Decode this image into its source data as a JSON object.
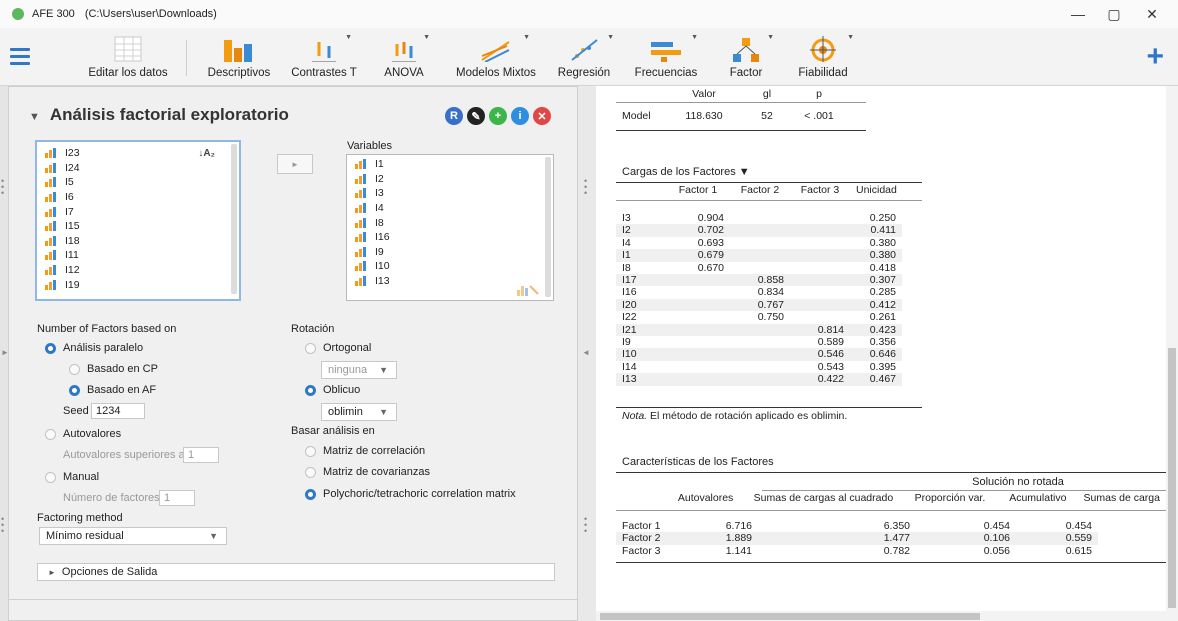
{
  "window": {
    "app_name": "AFE 300",
    "path": "(C:\\Users\\user\\Downloads)",
    "minimize": "—",
    "restore": "▢",
    "close": "✕"
  },
  "ribbon": {
    "buttons": [
      "Editar los datos",
      "Descriptivos",
      "Contrastes T",
      "ANOVA",
      "Modelos Mixtos",
      "Regresión",
      "Frecuencias",
      "Factor",
      "Fiabilidad"
    ],
    "plus": "+"
  },
  "analysis": {
    "title": "Análisis factorial exploratorio",
    "header_buttons": [
      "R",
      "✎",
      "+",
      "i",
      "✕"
    ],
    "available_vars": [
      "I23",
      "I24",
      "I5",
      "I6",
      "I7",
      "I15",
      "I18",
      "I11",
      "I12",
      "I19"
    ],
    "variables_label": "Variables",
    "selected_vars": [
      "I1",
      "I2",
      "I3",
      "I4",
      "I8",
      "I16",
      "I9",
      "I10",
      "I13"
    ],
    "sort_icon": "↓A₂",
    "move_arrow": "►",
    "nfactors": {
      "label": "Number of Factors based on",
      "parallel": "Análisis paralelo",
      "based_cp": "Basado en CP",
      "based_af": "Basado en AF",
      "seed_label": "Seed",
      "seed_value": "1234",
      "eigen": "Autovalores",
      "eigen_above": "Autovalores superiores a",
      "eigen_value": "1",
      "manual": "Manual",
      "nfactor_label": "Número de factores",
      "nfactor_value": "1"
    },
    "factoring": {
      "label": "Factoring method",
      "value": "Mínimo residual"
    },
    "rotation": {
      "label": "Rotación",
      "orthogonal": "Ortogonal",
      "orth_value": "ninguna",
      "oblique": "Oblicuo",
      "obl_value": "oblimin"
    },
    "base": {
      "label": "Basar análisis en",
      "corr": "Matriz de correlación",
      "cov": "Matriz de covarianzas",
      "poly": "Polychoric/tetrachoric correlation matrix"
    },
    "output_options": "Opciones de Salida"
  },
  "results": {
    "model_table": {
      "headers": [
        "",
        "Valor",
        "gl",
        "p"
      ],
      "row": [
        "Model",
        "118.630",
        "52",
        "< .001"
      ]
    },
    "loadings": {
      "title": "Cargas de los Factores ▼",
      "headers": [
        "",
        "Factor 1",
        "Factor 2",
        "Factor 3",
        "Unicidad"
      ],
      "rows": [
        [
          "I3",
          "0.904",
          "",
          "",
          "0.250"
        ],
        [
          "I2",
          "0.702",
          "",
          "",
          "0.411"
        ],
        [
          "I4",
          "0.693",
          "",
          "",
          "0.380"
        ],
        [
          "I1",
          "0.679",
          "",
          "",
          "0.380"
        ],
        [
          "I8",
          "0.670",
          "",
          "",
          "0.418"
        ],
        [
          "I17",
          "",
          "0.858",
          "",
          "0.307"
        ],
        [
          "I16",
          "",
          "0.834",
          "",
          "0.285"
        ],
        [
          "I20",
          "",
          "0.767",
          "",
          "0.412"
        ],
        [
          "I22",
          "",
          "0.750",
          "",
          "0.261"
        ],
        [
          "I21",
          "",
          "",
          "0.814",
          "0.423"
        ],
        [
          "I9",
          "",
          "",
          "0.589",
          "0.356"
        ],
        [
          "I10",
          "",
          "",
          "0.546",
          "0.646"
        ],
        [
          "I14",
          "",
          "",
          "0.543",
          "0.395"
        ],
        [
          "I13",
          "",
          "",
          "0.422",
          "0.467"
        ]
      ],
      "note_prefix": "Nota.",
      "note_text": " El método de rotación aplicado es oblimin."
    },
    "characteristics": {
      "title": "Características de los Factores",
      "group": "Solución no rotada",
      "headers": [
        "",
        "Autovalores",
        "Sumas de cargas al cuadrado",
        "Proporción var.",
        "Acumulativo",
        "Sumas de carga"
      ],
      "rows": [
        [
          "Factor 1",
          "6.716",
          "6.350",
          "0.454",
          "0.454"
        ],
        [
          "Factor 2",
          "1.889",
          "1.477",
          "0.106",
          "0.559"
        ],
        [
          "Factor 3",
          "1.141",
          "0.782",
          "0.056",
          "0.615"
        ]
      ]
    }
  }
}
